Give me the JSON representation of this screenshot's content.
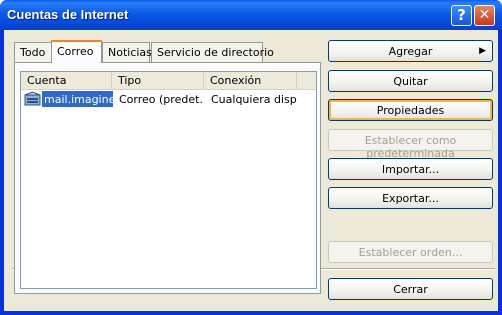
{
  "window": {
    "title": "Cuentas de Internet",
    "help_icon_glyph": "?",
    "close_icon_glyph": "✕"
  },
  "tabs": [
    {
      "label": "Todo",
      "active": false
    },
    {
      "label": "Correo",
      "active": true
    },
    {
      "label": "Noticias",
      "active": false
    },
    {
      "label": "Servicio de directorio",
      "active": false
    }
  ],
  "list": {
    "columns": [
      "Cuenta",
      "Tipo",
      "Conexión"
    ],
    "rows": [
      {
        "cuenta": "mail.imagine....",
        "tipo": "Correo (predet...",
        "conexion": "Cualquiera disp...",
        "selected": true,
        "icon": "mail-account-icon"
      }
    ]
  },
  "buttons": {
    "agregar": "Agregar",
    "quitar": "Quitar",
    "propiedades": "Propiedades",
    "establecer": "Establecer como predeterminada",
    "importar": "Importar...",
    "exportar": "Exportar...",
    "orden": "Establecer orden...",
    "cerrar": "Cerrar"
  },
  "colors": {
    "titlebar": "#0a5fe8",
    "selection": "#316ac5",
    "dialog_bg": "#ece9d8",
    "tab_accent": "#e68b2c"
  }
}
